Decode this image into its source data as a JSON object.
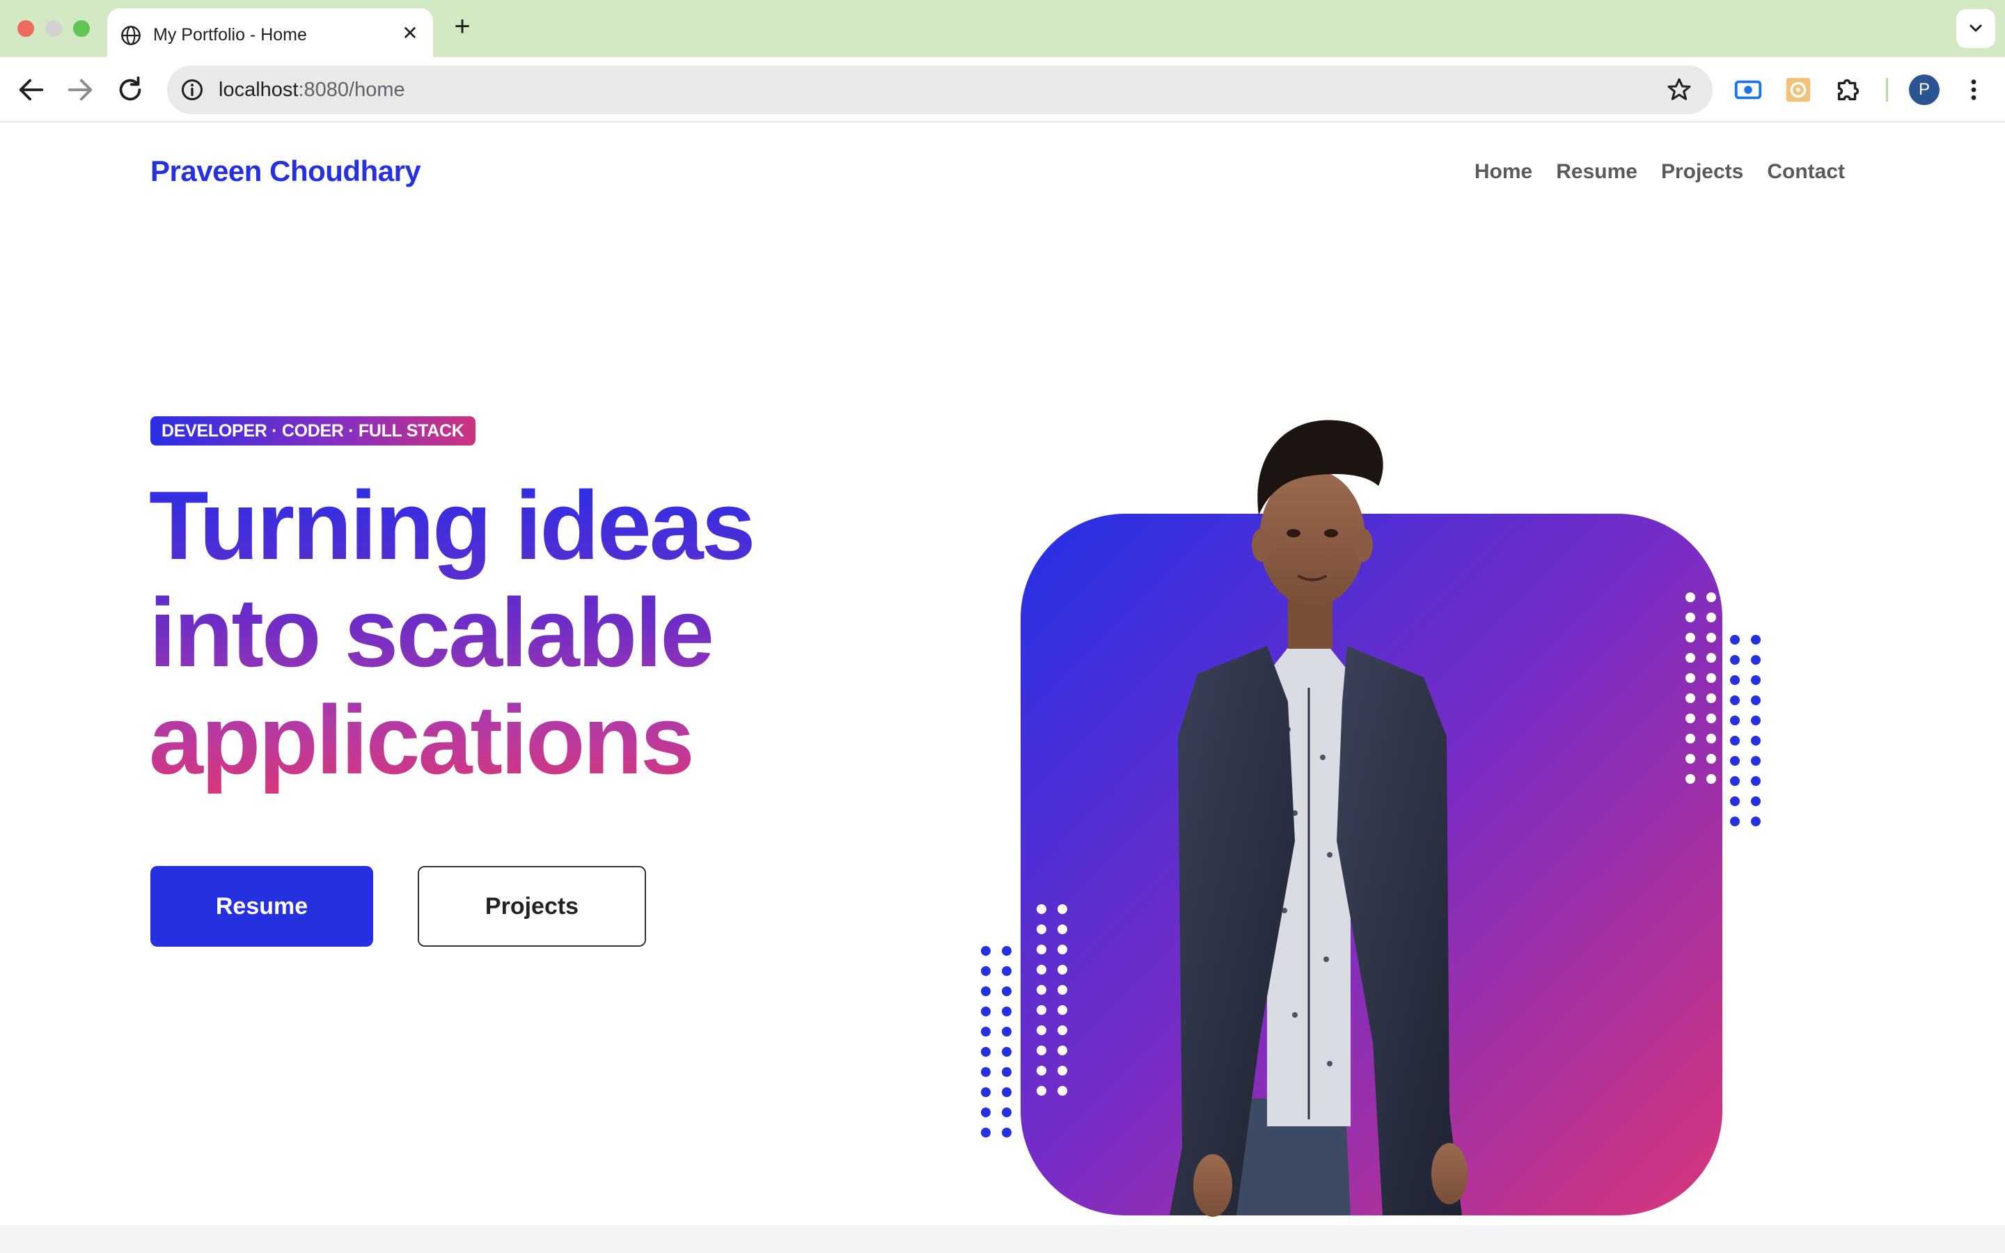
{
  "browser": {
    "tab_title": "My Portfolio - Home",
    "new_tab_symbol": "+",
    "close_symbol": "✕",
    "url_host": "localhost",
    "url_path": ":8080/home",
    "profile_initial": "P",
    "colors": {
      "tabbar": "#d3e9c4",
      "omnibox": "#e9e9e9"
    }
  },
  "site": {
    "brand": "Praveen Choudhary",
    "nav": [
      "Home",
      "Resume",
      "Projects",
      "Contact"
    ]
  },
  "hero": {
    "badge": "DEVELOPER · CODER · FULL STACK",
    "headline_lines": [
      "Turning ideas",
      "into scalable",
      "applications"
    ],
    "primary_button": "Resume",
    "secondary_button": "Projects",
    "colors": {
      "primary": "#2530e0",
      "gradient_start": "#2a2fe6",
      "gradient_end": "#d8367a"
    }
  },
  "icons": [
    "globe-icon",
    "back-icon",
    "forward-icon",
    "reload-icon",
    "info-icon",
    "star-icon",
    "extension-icon",
    "puzzle-icon",
    "kebab-menu-icon",
    "chevron-down-icon"
  ]
}
